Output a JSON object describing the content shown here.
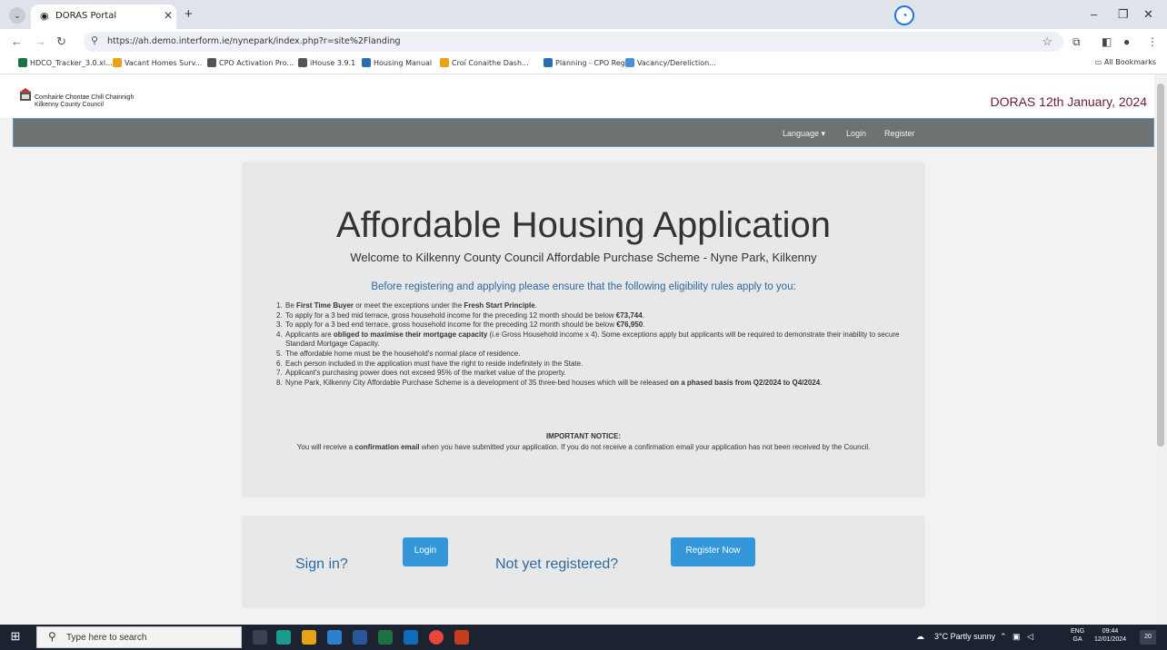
{
  "browser": {
    "tab_title": "DORAS Portal",
    "url": "https://ah.demo.interform.ie/nynepark/index.php?r=site%2Flanding",
    "bookmarks": [
      {
        "label": "HDCO_Tracker_3.0.xl...",
        "color": "#1e7145"
      },
      {
        "label": "Vacant Homes Surv...",
        "color": "#e8a317"
      },
      {
        "label": "CPO Activation Pro...",
        "color": "#555555"
      },
      {
        "label": "iHouse 3.9.1",
        "color": "#555555"
      },
      {
        "label": "Housing Manual",
        "color": "#2b6cb0"
      },
      {
        "label": "Croí Conaithe Dash...",
        "color": "#e8a317"
      },
      {
        "label": "Planning - CPO Regi...",
        "color": "#2b6cb0"
      },
      {
        "label": "Vacancy/Dereliction...",
        "color": "#4a90d9"
      }
    ],
    "all_bookmarks": "All Bookmarks"
  },
  "header": {
    "org_line1": "Comhairle Chontae Chill Chainnigh",
    "org_line2": "Kilkenny County Council",
    "doras_date": "DORAS 12th January, 2024"
  },
  "nav": {
    "language": "Language ▾",
    "login": "Login",
    "register": "Register"
  },
  "main": {
    "title": "Affordable Housing Application",
    "welcome": "Welcome to Kilkenny County Council Affordable Purchase Scheme - Nyne Park, Kilkenny",
    "before": "Before registering and applying please ensure that the following eligibility rules apply to you:",
    "rules": [
      {
        "num": "1.",
        "a": "Be ",
        "b": "First Time Buyer",
        "c": " or meet the exceptions under the ",
        "d": "Fresh Start Principle",
        "e": "."
      },
      {
        "num": "2.",
        "a": "To apply for a 3 bed mid terrace, gross household income for the preceding 12 month should be below ",
        "b": "€73,744",
        "c": ".",
        "d": "",
        "e": ""
      },
      {
        "num": "3.",
        "a": "To apply for a 3 bed end terrace, gross household income for the preceding 12 month should be below ",
        "b": "€76,950",
        "c": ".",
        "d": "",
        "e": ""
      },
      {
        "num": "4.",
        "a": "Applicants are ",
        "b": "obliged to maximise their mortgage capacity",
        "c": " (i.e Gross Household income x 4). Some exceptions apply but applicants will be required to demonstrate their inability to secure Standard Mortgage Capacity.",
        "d": "",
        "e": ""
      },
      {
        "num": "5.",
        "a": "The affordable home must be the household's normal place of residence.",
        "b": "",
        "c": "",
        "d": "",
        "e": ""
      },
      {
        "num": "6.",
        "a": "Each person included in the application must have the right to reside indefinitely in the State.",
        "b": "",
        "c": "",
        "d": "",
        "e": ""
      },
      {
        "num": "7.",
        "a": "Applicant's purchasing power does not exceed 95% of the market value of the property.",
        "b": "",
        "c": "",
        "d": "",
        "e": ""
      },
      {
        "num": "8.",
        "a": "Nyne Park, Kilkenny City Affordable Purchase Scheme is a development of 35 three-bed houses which will be released ",
        "b": "on a phased basis from Q2/2024 to Q4/2024",
        "c": ".",
        "d": "",
        "e": ""
      }
    ],
    "notice_title": "IMPORTANT NOTICE:",
    "notice_a": "You will receive a ",
    "notice_b": "confirmation email",
    "notice_c": " when you have submitted your application. If you do not receive a confirmation email your application has not been received by the Council."
  },
  "actions": {
    "sign_in": "Sign in?",
    "login_button": "Login",
    "not_registered": "Not yet registered?",
    "register_button": "Register Now"
  },
  "taskbar": {
    "search_placeholder": "Type here to search",
    "weather": "3°C  Partly sunny",
    "lang1": "ENG",
    "lang2": "GA",
    "time": "09:44",
    "date": "12/01/2024",
    "notifications": "20"
  }
}
